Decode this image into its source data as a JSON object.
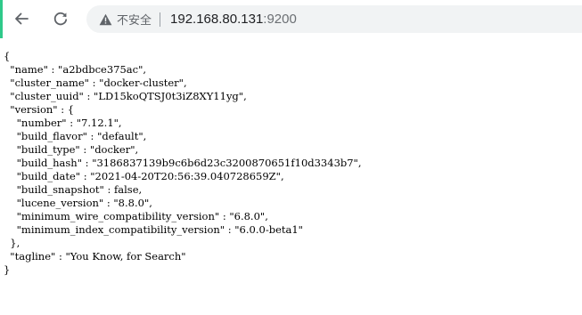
{
  "browser": {
    "security_label": "不安全",
    "url_host": "192.168.80.131",
    "url_port": ":9200",
    "colors": {
      "accent": "#2fc98a",
      "omnibox_bg": "#f1f3f4",
      "icon": "#5f6368"
    }
  },
  "json_lines": [
    "{",
    "  \"name\" : \"a2bdbce375ac\",",
    "  \"cluster_name\" : \"docker-cluster\",",
    "  \"cluster_uuid\" : \"LD15koQTSJ0t3iZ8XY11yg\",",
    "  \"version\" : {",
    "    \"number\" : \"7.12.1\",",
    "    \"build_flavor\" : \"default\",",
    "    \"build_type\" : \"docker\",",
    "    \"build_hash\" : \"3186837139b9c6b6d23c3200870651f10d3343b7\",",
    "    \"build_date\" : \"2021-04-20T20:56:39.040728659Z\",",
    "    \"build_snapshot\" : false,",
    "    \"lucene_version\" : \"8.8.0\",",
    "    \"minimum_wire_compatibility_version\" : \"6.8.0\",",
    "    \"minimum_index_compatibility_version\" : \"6.0.0-beta1\"",
    "  },",
    "  \"tagline\" : \"You Know, for Search\"",
    "}"
  ]
}
